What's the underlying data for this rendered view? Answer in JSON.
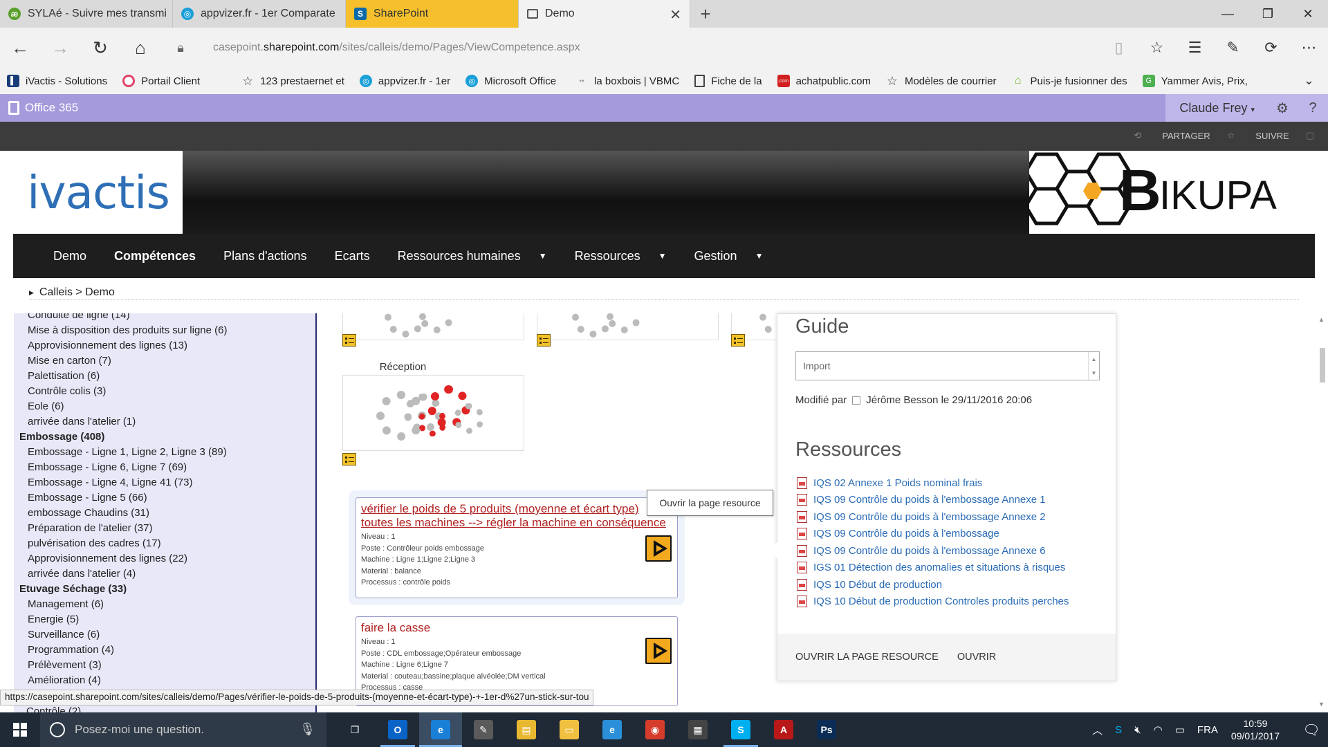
{
  "browser": {
    "tabs": [
      {
        "title": "SYLAé - Suivre mes transmi",
        "icon": "sylae-icon",
        "color": "#5aa02c"
      },
      {
        "title": "appvizer.fr - 1er Comparate",
        "icon": "appvizer-icon",
        "color": "#1a9fd8"
      },
      {
        "title": "SharePoint",
        "icon": "sharepoint-icon",
        "color": "#0a6aa8"
      },
      {
        "title": "Demo",
        "icon": "page-icon",
        "color": "#555555"
      }
    ],
    "url_prefix": "casepoint.",
    "url_domain": "sharepoint.com",
    "url_path": "/sites/calleis/demo/Pages/ViewCompetence.aspx",
    "favorites": [
      {
        "label": "iVactis - Solutions",
        "icon": "ivactis-fav-icon",
        "color": "#1a3d7a"
      },
      {
        "label": "Portail Client",
        "icon": "portail-fav-icon",
        "color": "#e0436a"
      },
      {
        "label": "123 prestaernet et",
        "icon": "star-icon",
        "color": "#444444"
      },
      {
        "label": "appvizer.fr - 1er",
        "icon": "appvizer-fav-icon",
        "color": "#1a9fd8"
      },
      {
        "label": "Microsoft Office",
        "icon": "office-fav-icon",
        "color": "#1a9fd8"
      },
      {
        "label": "la boxbois | VBMC",
        "icon": "boxbois-fav-icon",
        "color": "#bbbbbb"
      },
      {
        "label": "Fiche de la",
        "icon": "page-fav-icon",
        "color": "#444444"
      },
      {
        "label": "achatpublic.com",
        "icon": "achat-fav-icon",
        "color": "#d22020"
      },
      {
        "label": "Modèles de courrier",
        "icon": "star-icon",
        "color": "#444444"
      },
      {
        "label": "Puis-je fusionner des",
        "icon": "fusion-fav-icon",
        "color": "#78b82a"
      },
      {
        "label": "Yammer Avis, Prix,",
        "icon": "yammer-fav-icon",
        "color": "#4caf50"
      }
    ]
  },
  "suite": {
    "brand": "Office 365",
    "user": "Claude Frey",
    "share": "PARTAGER",
    "follow": "SUIVRE"
  },
  "banner": {
    "left_logo": "ivactis",
    "right_logo": "IKUPA"
  },
  "nav": {
    "items": [
      {
        "label": "Demo"
      },
      {
        "label": "Compétences"
      },
      {
        "label": "Plans d'actions"
      },
      {
        "label": "Ecarts"
      },
      {
        "label": "Ressources humaines"
      },
      {
        "label": "Ressources"
      },
      {
        "label": "Gestion"
      }
    ]
  },
  "breadcrumb": "Calleis > Demo",
  "tree": {
    "items": [
      {
        "label": "Conduite de ligne (14)",
        "group": false
      },
      {
        "label": "Mise à disposition des produits sur ligne (6)",
        "group": false
      },
      {
        "label": "Approvisionnement des lignes (13)",
        "group": false
      },
      {
        "label": "Mise en carton (7)",
        "group": false
      },
      {
        "label": "Palettisation (6)",
        "group": false
      },
      {
        "label": "Contrôle colis (3)",
        "group": false
      },
      {
        "label": "Eole (6)",
        "group": false
      },
      {
        "label": "arrivée dans l'atelier (1)",
        "group": false
      },
      {
        "label": "Embossage (408)",
        "group": true
      },
      {
        "label": "Embossage - Ligne 1, Ligne 2, Ligne 3 (89)",
        "group": false
      },
      {
        "label": "Embossage - Ligne 6, Ligne 7 (69)",
        "group": false
      },
      {
        "label": "Embossage - Ligne 4, Ligne 41 (73)",
        "group": false
      },
      {
        "label": "Embossage - Ligne 5 (66)",
        "group": false
      },
      {
        "label": "embossage Chaudins (31)",
        "group": false
      },
      {
        "label": "Préparation de l'atelier (37)",
        "group": false
      },
      {
        "label": "pulvérisation des cadres (17)",
        "group": false
      },
      {
        "label": "Approvisionnement des lignes (22)",
        "group": false
      },
      {
        "label": "arrivée dans l'atelier (4)",
        "group": false
      },
      {
        "label": "Etuvage Séchage (33)",
        "group": true
      },
      {
        "label": "Management (6)",
        "group": false
      },
      {
        "label": "Energie (5)",
        "group": false
      },
      {
        "label": "Surveillance (6)",
        "group": false
      },
      {
        "label": "Programmation (4)",
        "group": false
      },
      {
        "label": "Prélèvement (3)",
        "group": false
      },
      {
        "label": "Amélioration (4)",
        "group": false
      }
    ],
    "cutoff_item": "Contrôle (2)"
  },
  "center": {
    "tile_caption": "Réception",
    "cards": [
      {
        "title_line1": "vérifier le poids de 5 produits (moyenne et écart type)",
        "title_line2": "toutes les machines --> régler la machine en conséquence",
        "niveau": "Niveau : 1",
        "poste": "Poste : Contrôleur poids embossage",
        "machine": "Machine : Ligne 1;Ligne 2;Ligne 3",
        "material": "Material : balance",
        "processus": "Processus : contrôle poids"
      },
      {
        "title_line1": "faire la casse",
        "niveau": "Niveau : 1",
        "poste": "Poste : CDL embossage;Opérateur embossage",
        "machine": "Machine : Ligne 6;Ligne 7",
        "material": "Material : couteau;bassine;plaque alvéolée;DM vertical",
        "processus": "Processus : casse"
      }
    ],
    "tooltip": "Ouvrir la page resource"
  },
  "panel": {
    "guide_title": "Guide",
    "guide_select": "Import",
    "modified_by": "Modifié par",
    "modified_user": "Jérôme Besson",
    "modified_date": "le 29/11/2016 20:06",
    "resources_title": "Ressources",
    "resources": [
      "IQS 02 Annexe 1 Poids nominal frais",
      "IQS 09 Contrôle du poids à l'embossage Annexe 1",
      "IQS 09 Contrôle du poids à l'embossage Annexe 2",
      "IQS 09 Contrôle du poids à l'embossage",
      "IQS 09 Contrôle du poids à l'embossage Annexe 6",
      "IGS 01 Détection des anomalies et situations à risques",
      "IQS 10 Début de production",
      "IQS 10 Début de production Controles produits perches"
    ],
    "footer_open_page": "OUVRIR LA PAGE RESOURCE",
    "footer_open": "OUVRIR"
  },
  "status_url": "https://casepoint.sharepoint.com/sites/calleis/demo/Pages/vérifier-le-poids-de-5-produits-(moyenne-et-écart-type)-+-1er-d%27un-stick-sur-tou",
  "taskbar": {
    "search_placeholder": "Posez-moi une question.",
    "apps": [
      {
        "name": "task-view-icon",
        "glyph": "❐",
        "color": "transparent",
        "state": ""
      },
      {
        "name": "outlook-icon",
        "glyph": "O",
        "color": "#0a64c8",
        "state": "running"
      },
      {
        "name": "edge-icon",
        "glyph": "e",
        "color": "#1a7fd6",
        "state": "active"
      },
      {
        "name": "paint-icon",
        "glyph": "✎",
        "color": "#5a5a5a",
        "state": ""
      },
      {
        "name": "file-tool-icon",
        "glyph": "▤",
        "color": "#e8b830",
        "state": ""
      },
      {
        "name": "file-explorer-icon",
        "glyph": "▭",
        "color": "#f0c040",
        "state": ""
      },
      {
        "name": "internet-explorer-icon",
        "glyph": "e",
        "color": "#2a8fd8",
        "state": ""
      },
      {
        "name": "chrome-icon",
        "glyph": "◉",
        "color": "#d63c2c",
        "state": ""
      },
      {
        "name": "calculator-icon",
        "glyph": "▦",
        "color": "#444444",
        "state": ""
      },
      {
        "name": "skype-icon",
        "glyph": "S",
        "color": "#00aff0",
        "state": "running"
      },
      {
        "name": "acrobat-icon",
        "glyph": "A",
        "color": "#b81818",
        "state": ""
      },
      {
        "name": "photoshop-icon",
        "glyph": "Ps",
        "color": "#0b2c54",
        "state": ""
      }
    ],
    "lang": "FRA",
    "time": "10:59",
    "date": "09/01/2017"
  }
}
